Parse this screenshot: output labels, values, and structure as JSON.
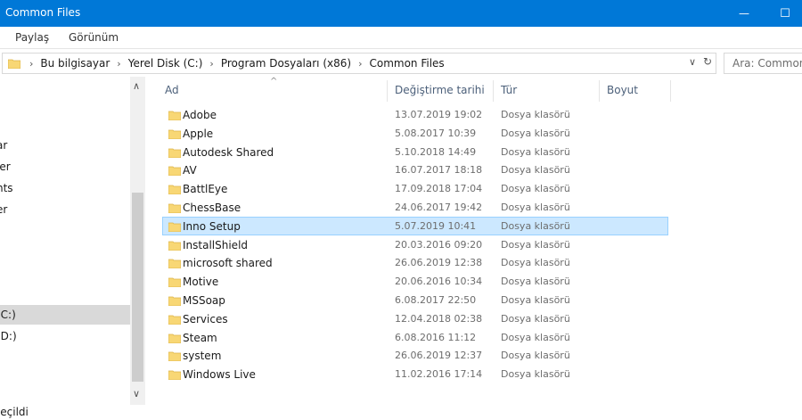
{
  "window": {
    "title": "Common Files",
    "min_glyph": "—",
    "max_glyph": "☐"
  },
  "ribbon": {
    "tabs": [
      "Paylaş",
      "Görünüm"
    ]
  },
  "address": {
    "crumbs": [
      "Bu bilgisayar",
      "Yerel Disk (C:)",
      "Program Dosyaları (x86)",
      "Common Files"
    ],
    "separator": "›",
    "dropdown_glyph": "∨",
    "refresh_glyph": "↻"
  },
  "search": {
    "placeholder": "Ara: Common Files"
  },
  "nav": {
    "items": [
      {
        "label": "ar",
        "selected": false
      },
      {
        "label": "ler",
        "selected": false
      },
      {
        "label": "nts",
        "selected": false
      },
      {
        "label": "er",
        "selected": false
      },
      {
        "label": "(C:)",
        "selected": true
      },
      {
        "label": "(D:)",
        "selected": false
      }
    ]
  },
  "scroll": {
    "up_glyph": "∧",
    "down_glyph": "∨"
  },
  "columns": {
    "name": "Ad",
    "date": "Değiştirme tarihi",
    "type": "Tür",
    "size": "Boyut",
    "sort_glyph": "^"
  },
  "files": [
    {
      "name": "Adobe",
      "date": "13.07.2019 19:02",
      "type": "Dosya klasörü",
      "selected": false
    },
    {
      "name": "Apple",
      "date": "5.08.2017 10:39",
      "type": "Dosya klasörü",
      "selected": false
    },
    {
      "name": "Autodesk Shared",
      "date": "5.10.2018 14:49",
      "type": "Dosya klasörü",
      "selected": false
    },
    {
      "name": "AV",
      "date": "16.07.2017 18:18",
      "type": "Dosya klasörü",
      "selected": false
    },
    {
      "name": "BattlEye",
      "date": "17.09.2018 17:04",
      "type": "Dosya klasörü",
      "selected": false
    },
    {
      "name": "ChessBase",
      "date": "24.06.2017 19:42",
      "type": "Dosya klasörü",
      "selected": false
    },
    {
      "name": "Inno Setup",
      "date": "5.07.2019 10:41",
      "type": "Dosya klasörü",
      "selected": true
    },
    {
      "name": "InstallShield",
      "date": "20.03.2016 09:20",
      "type": "Dosya klasörü",
      "selected": false
    },
    {
      "name": "microsoft shared",
      "date": "26.06.2019 12:38",
      "type": "Dosya klasörü",
      "selected": false
    },
    {
      "name": "Motive",
      "date": "20.06.2016 10:34",
      "type": "Dosya klasörü",
      "selected": false
    },
    {
      "name": "MSSoap",
      "date": "6.08.2017 22:50",
      "type": "Dosya klasörü",
      "selected": false
    },
    {
      "name": "Services",
      "date": "12.04.2018 02:38",
      "type": "Dosya klasörü",
      "selected": false
    },
    {
      "name": "Steam",
      "date": "6.08.2016 11:12",
      "type": "Dosya klasörü",
      "selected": false
    },
    {
      "name": "system",
      "date": "26.06.2019 12:37",
      "type": "Dosya klasörü",
      "selected": false
    },
    {
      "name": "Windows Live",
      "date": "11.02.2016 17:14",
      "type": "Dosya klasörü",
      "selected": false
    }
  ],
  "status": {
    "text": "seçildi"
  },
  "colors": {
    "titlebar": "#0078d7",
    "folder": "#f8d775",
    "selection": "#cce8ff",
    "selection_border": "#99d1ff",
    "nav_selected": "#d9d9d9"
  }
}
